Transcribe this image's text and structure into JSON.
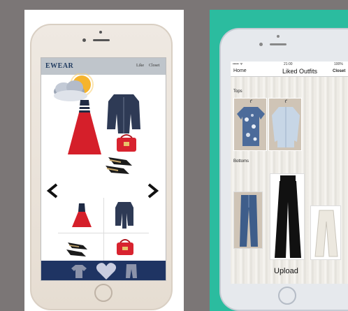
{
  "left_app": {
    "brand": "EWEAR",
    "nav_like": "Like",
    "nav_closet": "Closet",
    "icons": [
      "weather-sun-cloud-icon",
      "arrow-left-icon",
      "arrow-right-icon",
      "shirt-icon",
      "heart-icon",
      "pants-icon"
    ],
    "colors": {
      "nav_bar": "#1f3463",
      "header_bar": "#bfc5cb",
      "brand_text": "#1f3a5f"
    }
  },
  "right_app": {
    "header": {
      "home": "Home",
      "title": "Liked Outfits",
      "closet": "Closet"
    },
    "status": {
      "carrier": "•••••  ᯤ",
      "time": "21:00",
      "battery": "100%"
    },
    "sections": {
      "tops": "Tops",
      "bottoms": "Bottoms"
    },
    "upload_label": "Upload",
    "colors": {
      "panel_bg": "#2bbc9f"
    }
  }
}
